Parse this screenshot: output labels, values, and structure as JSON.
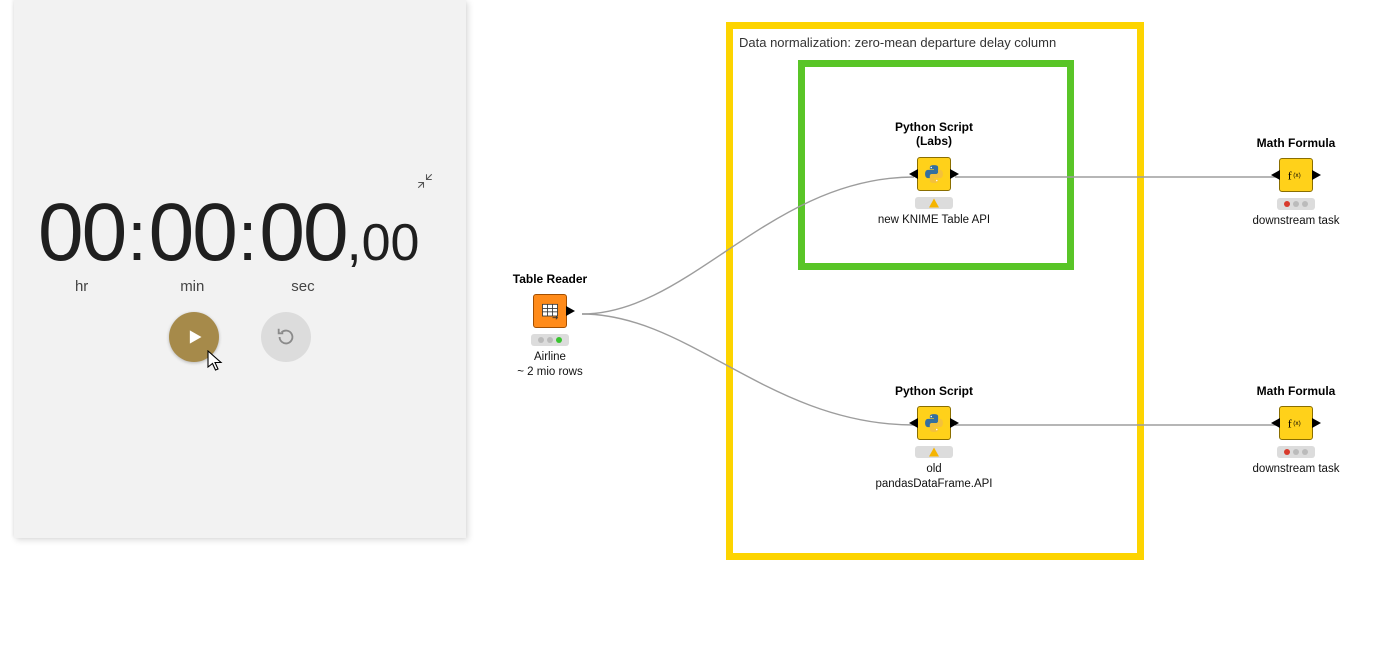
{
  "stopwatch": {
    "hours": "00",
    "minutes": "00",
    "seconds": "00",
    "centiseconds": "00",
    "labels": {
      "hr": "hr",
      "min": "min",
      "sec": "sec"
    },
    "buttons": {
      "play": "play",
      "reset": "reset"
    }
  },
  "workflow": {
    "annotation_outer": "Data normalization: zero-mean  departure delay  column",
    "nodes": {
      "table_reader": {
        "title": "Table Reader",
        "sub": "Airline\n~ 2 mio rows"
      },
      "python_labs": {
        "title": "Python Script\n(Labs)",
        "sub": "new KNIME Table API"
      },
      "python_old": {
        "title": "Python Script",
        "sub": "old\npandasDataFrame.API"
      },
      "math_top": {
        "title": "Math Formula",
        "sub": "downstream task"
      },
      "math_bottom": {
        "title": "Math Formula",
        "sub": "downstream task"
      }
    }
  }
}
